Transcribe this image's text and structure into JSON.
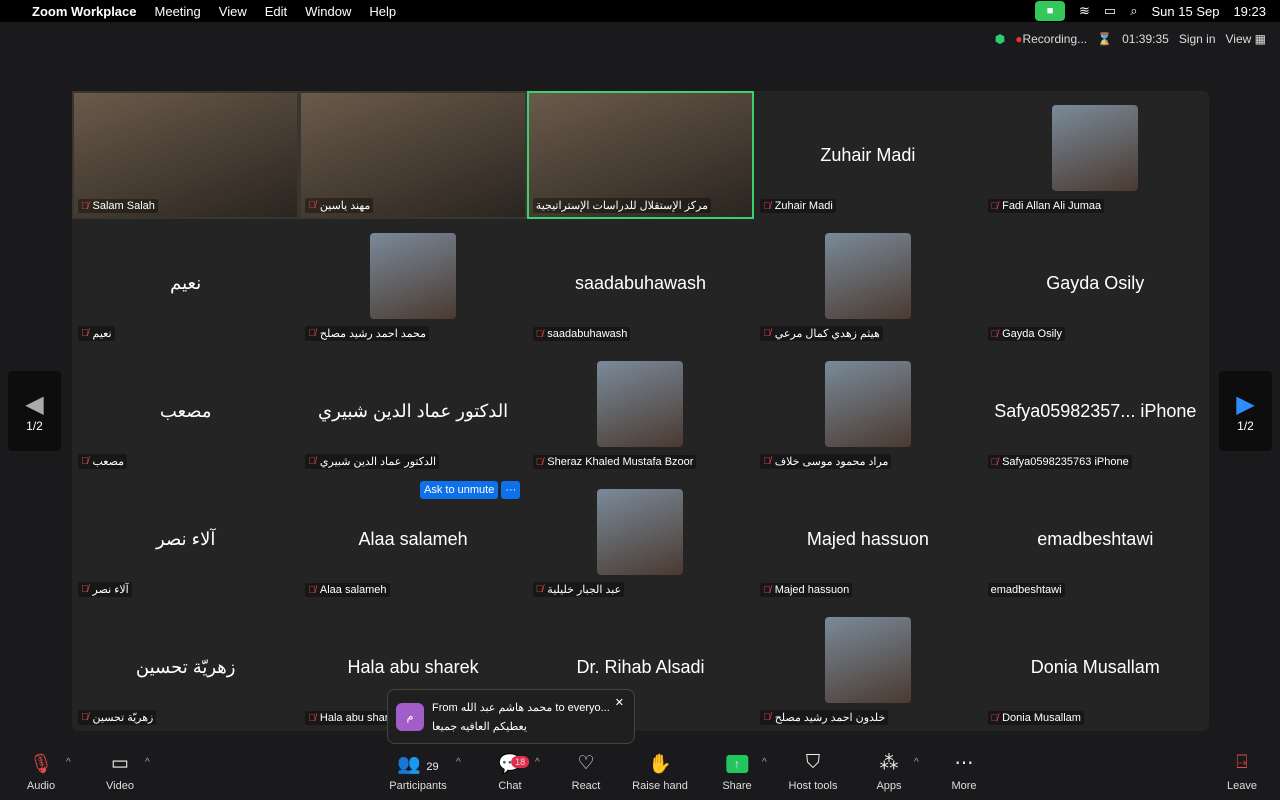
{
  "menubar": {
    "app": "Zoom Workplace",
    "items": [
      "Meeting",
      "View",
      "Edit",
      "Window",
      "Help"
    ],
    "date": "Sun 15 Sep",
    "time": "19:23"
  },
  "topbar": {
    "recording": "Recording...",
    "timer": "01:39:35",
    "sign_in": "Sign in",
    "view": "View"
  },
  "tiles": [
    {
      "label": "Salam Salah",
      "video": true
    },
    {
      "label": "مهند ياسين",
      "video": true
    },
    {
      "label": "مركز الإستقلال للدراسات الإستراتيجية",
      "video": true,
      "active": true,
      "nomute": true
    },
    {
      "label": "Zuhair Madi",
      "big": "Zuhair Madi"
    },
    {
      "label": "Fadi Allan Ali Jumaa",
      "photo": true
    },
    {
      "label": "نعيم",
      "big": "نعيم"
    },
    {
      "label": "محمد احمد رشيد مصلح",
      "photo": true
    },
    {
      "label": "saadabuhawash",
      "big": "saadabuhawash"
    },
    {
      "label": "هيثم زهدي كمال مرعي",
      "photo": true
    },
    {
      "label": "Gayda Osily",
      "big": "Gayda Osily"
    },
    {
      "label": "مصعب",
      "big": "مصعب"
    },
    {
      "label": "الدكتور عماد الدين شبيري",
      "big": "الدكتور عماد الدين شبيري"
    },
    {
      "label": "Sheraz Khaled Mustafa Bzoor",
      "photo": true
    },
    {
      "label": "مراد محمود موسى خلاف",
      "photo": true
    },
    {
      "label": "Safya0598235763 iPhone",
      "big": "Safya05982357... iPhone"
    },
    {
      "label": "آلاء نصر",
      "big": "آلاء نصر"
    },
    {
      "label": "Alaa salameh",
      "big": "Alaa salameh"
    },
    {
      "label": "عبد الجبار خليلية",
      "photo": true
    },
    {
      "label": "Majed hassuon",
      "big": "Majed hassuon"
    },
    {
      "label": "emadbeshtawi",
      "big": "emadbeshtawi",
      "nomute": true
    },
    {
      "label": "زهريّة تحسين",
      "big": "زهريّة تحسين"
    },
    {
      "label": "Hala abu sharek",
      "big": "Hala abu sharek"
    },
    {
      "label": "",
      "big": "Dr. Rihab Alsadi",
      "nolabel": true
    },
    {
      "label": "خلدون احمد رشيد مصلح",
      "photo": true
    },
    {
      "label": "Donia Musallam",
      "big": "Donia Musallam"
    }
  ],
  "pager": {
    "page": "1/2"
  },
  "ask_unmute": {
    "label": "Ask to unmute",
    "more": "···"
  },
  "toast": {
    "avatar": "م",
    "title": "From محمد هاشم عبد الله to everyo...",
    "message": "يعطيكم العافيه جميعا",
    "close": "✕"
  },
  "toolbar": {
    "audio": "Audio",
    "video": "Video",
    "participants": "Participants",
    "participant_count": "29",
    "chat": "Chat",
    "chat_badge": "18",
    "react": "React",
    "raise_hand": "Raise hand",
    "share": "Share",
    "host_tools": "Host tools",
    "apps": "Apps",
    "more": "More",
    "leave": "Leave"
  }
}
